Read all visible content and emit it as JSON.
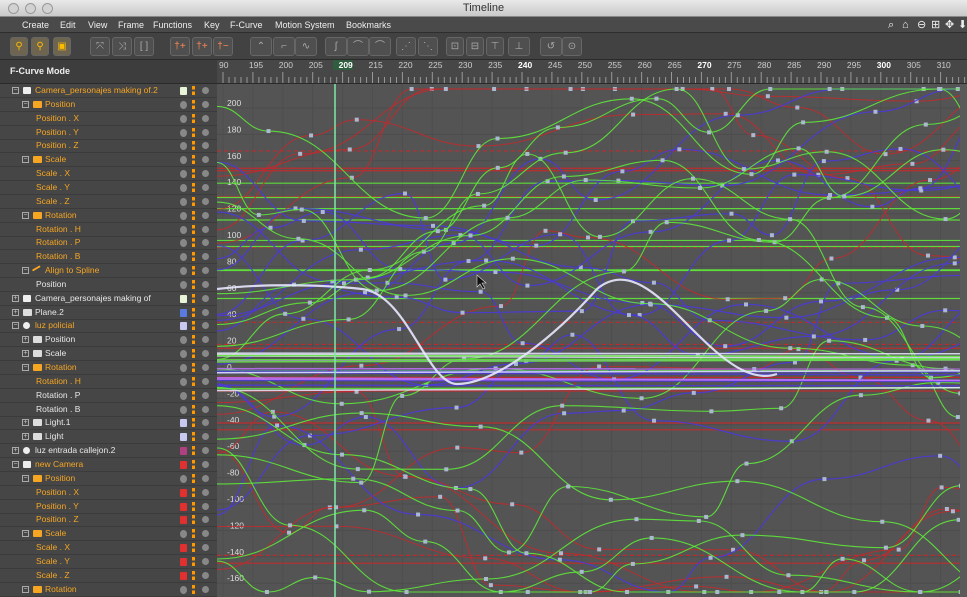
{
  "window": {
    "title": "Timeline"
  },
  "menu": [
    "Create",
    "Edit",
    "View",
    "Frame",
    "Functions",
    "Key",
    "F-Curve",
    "Motion System",
    "Bookmarks"
  ],
  "mode_label": "F-Curve Mode",
  "ruler": {
    "ticks": [
      "90",
      "195",
      "200",
      "205",
      "209",
      "215",
      "220",
      "225",
      "230",
      "235",
      "240",
      "245",
      "250",
      "255",
      "260",
      "265",
      "270",
      "275",
      "280",
      "285",
      "290",
      "295",
      "300",
      "305",
      "310"
    ],
    "current": "209"
  },
  "y_axis": [
    "200",
    "180",
    "160",
    "140",
    "120",
    "100",
    "80",
    "60",
    "40",
    "20",
    "0",
    "-20",
    "-40",
    "-60",
    "-80",
    "-100",
    "-120",
    "-140",
    "-160"
  ],
  "tree": [
    {
      "label": "Camera_personajes making of.2",
      "indent": 0,
      "color": "or",
      "icon": "camera",
      "exp": "−",
      "sw": "#e8f4d8"
    },
    {
      "label": "Position",
      "indent": 1,
      "color": "or",
      "icon": "folder",
      "exp": "−"
    },
    {
      "label": "Position . X",
      "indent": 2,
      "color": "or"
    },
    {
      "label": "Position . Y",
      "indent": 2,
      "color": "or"
    },
    {
      "label": "Position . Z",
      "indent": 2,
      "color": "or"
    },
    {
      "label": "Scale",
      "indent": 1,
      "color": "or",
      "icon": "folder",
      "exp": "−"
    },
    {
      "label": "Scale . X",
      "indent": 2,
      "color": "or"
    },
    {
      "label": "Scale . Y",
      "indent": 2,
      "color": "or"
    },
    {
      "label": "Scale . Z",
      "indent": 2,
      "color": "or"
    },
    {
      "label": "Rotation",
      "indent": 1,
      "color": "or",
      "icon": "folder",
      "exp": "−"
    },
    {
      "label": "Rotation . H",
      "indent": 2,
      "color": "or"
    },
    {
      "label": "Rotation . P",
      "indent": 2,
      "color": "or"
    },
    {
      "label": "Rotation . B",
      "indent": 2,
      "color": "or"
    },
    {
      "label": "Align to Spline",
      "indent": 1,
      "color": "or",
      "icon": "spline",
      "exp": "−"
    },
    {
      "label": "Position",
      "indent": 2,
      "color": "wh"
    },
    {
      "label": "Camera_personajes making of",
      "indent": 0,
      "color": "wh",
      "icon": "camera",
      "exp": "+",
      "sw": "#e8f4d8"
    },
    {
      "label": "Plane.2",
      "indent": 0,
      "color": "wh",
      "icon": "plane",
      "exp": "+",
      "sw": "#5a7ae0"
    },
    {
      "label": "luz policial",
      "indent": 0,
      "color": "or",
      "icon": "light",
      "exp": "−",
      "sw": "#c8c8f0"
    },
    {
      "label": "Position",
      "indent": 1,
      "color": "wh",
      "icon": "folder",
      "exp": "+"
    },
    {
      "label": "Scale",
      "indent": 1,
      "color": "wh",
      "icon": "folder",
      "exp": "+"
    },
    {
      "label": "Rotation",
      "indent": 1,
      "color": "or",
      "icon": "folder",
      "exp": "−"
    },
    {
      "label": "Rotation . H",
      "indent": 2,
      "color": "or"
    },
    {
      "label": "Rotation . P",
      "indent": 2,
      "color": "wh"
    },
    {
      "label": "Rotation . B",
      "indent": 2,
      "color": "wh"
    },
    {
      "label": "Light.1",
      "indent": 1,
      "color": "wh",
      "icon": "folder",
      "exp": "+",
      "sw": "#c8c8f0"
    },
    {
      "label": "Light",
      "indent": 1,
      "color": "wh",
      "icon": "folder",
      "exp": "+",
      "sw": "#c8c8f0"
    },
    {
      "label": "luz entrada callejon.2",
      "indent": 0,
      "color": "wh",
      "icon": "bulb",
      "exp": "+",
      "sw": "#b04080"
    },
    {
      "label": "new Camera",
      "indent": 0,
      "color": "or",
      "icon": "camera",
      "exp": "−",
      "sw": "#e03030"
    },
    {
      "label": "Position",
      "indent": 1,
      "color": "or",
      "icon": "folder",
      "exp": "−"
    },
    {
      "label": "Position . X",
      "indent": 2,
      "color": "or",
      "sw": "#e03030"
    },
    {
      "label": "Position . Y",
      "indent": 2,
      "color": "or",
      "sw": "#e03030"
    },
    {
      "label": "Position . Z",
      "indent": 2,
      "color": "or",
      "sw": "#e03030"
    },
    {
      "label": "Scale",
      "indent": 1,
      "color": "or",
      "icon": "folder",
      "exp": "−"
    },
    {
      "label": "Scale . X",
      "indent": 2,
      "color": "or",
      "sw": "#e03030"
    },
    {
      "label": "Scale . Y",
      "indent": 2,
      "color": "or",
      "sw": "#e03030"
    },
    {
      "label": "Scale . Z",
      "indent": 2,
      "color": "or",
      "sw": "#e03030"
    },
    {
      "label": "Rotation",
      "indent": 1,
      "color": "or",
      "icon": "folder",
      "exp": "−"
    }
  ],
  "colors": {
    "curve_green": "#5ee83a",
    "curve_red": "#c8282a",
    "curve_blue": "#4a3ad8",
    "curve_white": "#e8e8ff",
    "playhead": "#7ee8a8",
    "accent": "#f6a623"
  }
}
